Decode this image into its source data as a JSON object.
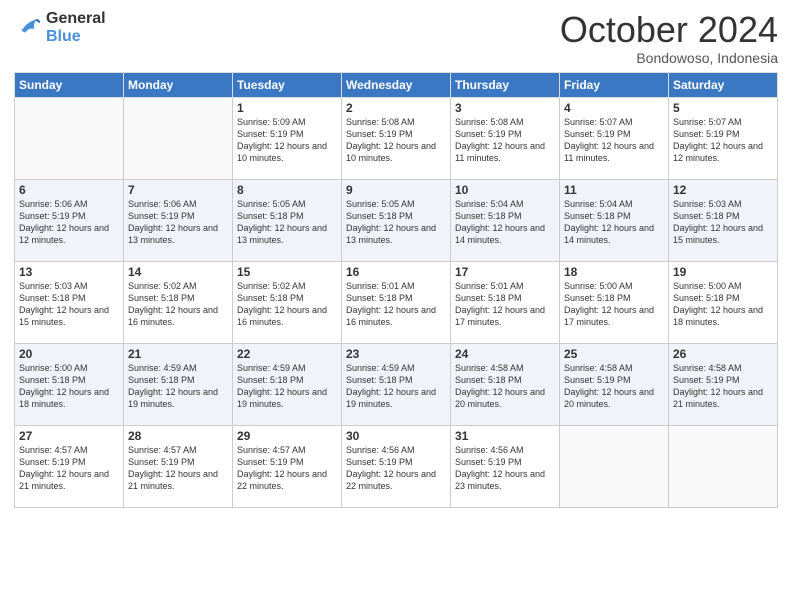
{
  "header": {
    "logo_line1": "General",
    "logo_line2": "Blue",
    "month": "October 2024",
    "location": "Bondowoso, Indonesia"
  },
  "days_of_week": [
    "Sunday",
    "Monday",
    "Tuesday",
    "Wednesday",
    "Thursday",
    "Friday",
    "Saturday"
  ],
  "weeks": [
    [
      {
        "day": "",
        "info": ""
      },
      {
        "day": "",
        "info": ""
      },
      {
        "day": "1",
        "info": "Sunrise: 5:09 AM\nSunset: 5:19 PM\nDaylight: 12 hours and 10 minutes."
      },
      {
        "day": "2",
        "info": "Sunrise: 5:08 AM\nSunset: 5:19 PM\nDaylight: 12 hours and 10 minutes."
      },
      {
        "day": "3",
        "info": "Sunrise: 5:08 AM\nSunset: 5:19 PM\nDaylight: 12 hours and 11 minutes."
      },
      {
        "day": "4",
        "info": "Sunrise: 5:07 AM\nSunset: 5:19 PM\nDaylight: 12 hours and 11 minutes."
      },
      {
        "day": "5",
        "info": "Sunrise: 5:07 AM\nSunset: 5:19 PM\nDaylight: 12 hours and 12 minutes."
      }
    ],
    [
      {
        "day": "6",
        "info": "Sunrise: 5:06 AM\nSunset: 5:19 PM\nDaylight: 12 hours and 12 minutes."
      },
      {
        "day": "7",
        "info": "Sunrise: 5:06 AM\nSunset: 5:19 PM\nDaylight: 12 hours and 13 minutes."
      },
      {
        "day": "8",
        "info": "Sunrise: 5:05 AM\nSunset: 5:18 PM\nDaylight: 12 hours and 13 minutes."
      },
      {
        "day": "9",
        "info": "Sunrise: 5:05 AM\nSunset: 5:18 PM\nDaylight: 12 hours and 13 minutes."
      },
      {
        "day": "10",
        "info": "Sunrise: 5:04 AM\nSunset: 5:18 PM\nDaylight: 12 hours and 14 minutes."
      },
      {
        "day": "11",
        "info": "Sunrise: 5:04 AM\nSunset: 5:18 PM\nDaylight: 12 hours and 14 minutes."
      },
      {
        "day": "12",
        "info": "Sunrise: 5:03 AM\nSunset: 5:18 PM\nDaylight: 12 hours and 15 minutes."
      }
    ],
    [
      {
        "day": "13",
        "info": "Sunrise: 5:03 AM\nSunset: 5:18 PM\nDaylight: 12 hours and 15 minutes."
      },
      {
        "day": "14",
        "info": "Sunrise: 5:02 AM\nSunset: 5:18 PM\nDaylight: 12 hours and 16 minutes."
      },
      {
        "day": "15",
        "info": "Sunrise: 5:02 AM\nSunset: 5:18 PM\nDaylight: 12 hours and 16 minutes."
      },
      {
        "day": "16",
        "info": "Sunrise: 5:01 AM\nSunset: 5:18 PM\nDaylight: 12 hours and 16 minutes."
      },
      {
        "day": "17",
        "info": "Sunrise: 5:01 AM\nSunset: 5:18 PM\nDaylight: 12 hours and 17 minutes."
      },
      {
        "day": "18",
        "info": "Sunrise: 5:00 AM\nSunset: 5:18 PM\nDaylight: 12 hours and 17 minutes."
      },
      {
        "day": "19",
        "info": "Sunrise: 5:00 AM\nSunset: 5:18 PM\nDaylight: 12 hours and 18 minutes."
      }
    ],
    [
      {
        "day": "20",
        "info": "Sunrise: 5:00 AM\nSunset: 5:18 PM\nDaylight: 12 hours and 18 minutes."
      },
      {
        "day": "21",
        "info": "Sunrise: 4:59 AM\nSunset: 5:18 PM\nDaylight: 12 hours and 19 minutes."
      },
      {
        "day": "22",
        "info": "Sunrise: 4:59 AM\nSunset: 5:18 PM\nDaylight: 12 hours and 19 minutes."
      },
      {
        "day": "23",
        "info": "Sunrise: 4:59 AM\nSunset: 5:18 PM\nDaylight: 12 hours and 19 minutes."
      },
      {
        "day": "24",
        "info": "Sunrise: 4:58 AM\nSunset: 5:18 PM\nDaylight: 12 hours and 20 minutes."
      },
      {
        "day": "25",
        "info": "Sunrise: 4:58 AM\nSunset: 5:19 PM\nDaylight: 12 hours and 20 minutes."
      },
      {
        "day": "26",
        "info": "Sunrise: 4:58 AM\nSunset: 5:19 PM\nDaylight: 12 hours and 21 minutes."
      }
    ],
    [
      {
        "day": "27",
        "info": "Sunrise: 4:57 AM\nSunset: 5:19 PM\nDaylight: 12 hours and 21 minutes."
      },
      {
        "day": "28",
        "info": "Sunrise: 4:57 AM\nSunset: 5:19 PM\nDaylight: 12 hours and 21 minutes."
      },
      {
        "day": "29",
        "info": "Sunrise: 4:57 AM\nSunset: 5:19 PM\nDaylight: 12 hours and 22 minutes."
      },
      {
        "day": "30",
        "info": "Sunrise: 4:56 AM\nSunset: 5:19 PM\nDaylight: 12 hours and 22 minutes."
      },
      {
        "day": "31",
        "info": "Sunrise: 4:56 AM\nSunset: 5:19 PM\nDaylight: 12 hours and 23 minutes."
      },
      {
        "day": "",
        "info": ""
      },
      {
        "day": "",
        "info": ""
      }
    ]
  ]
}
